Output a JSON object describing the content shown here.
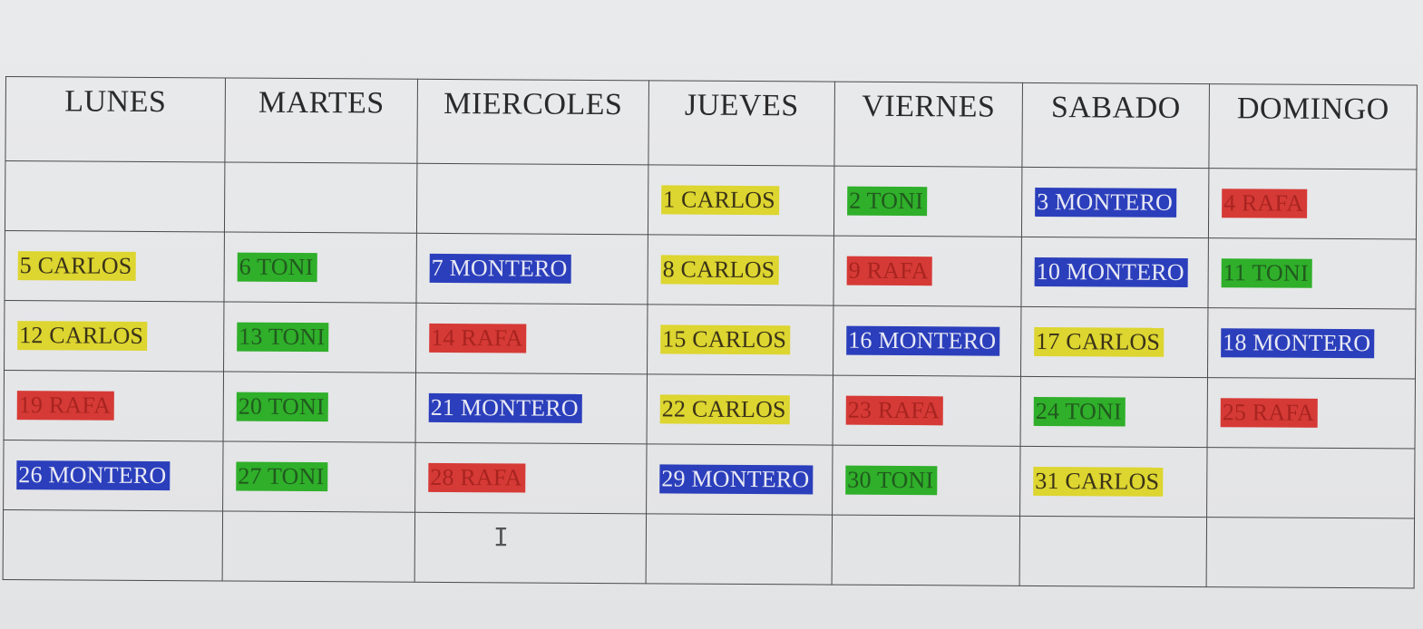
{
  "calendar": {
    "days": [
      "LUNES",
      "MARTES",
      "MIERCOLES",
      "JUEVES",
      "VIERNES",
      "SABADO",
      "DOMINGO"
    ],
    "colors": {
      "carlos": "#ddd530",
      "toni": "#2faf2a",
      "montero": "#2b3fbc",
      "rafa": "#d63a36"
    },
    "weeks": [
      [
        {
          "text": ""
        },
        {
          "text": ""
        },
        {
          "text": ""
        },
        {
          "text": "1 CARLOS",
          "person": "carlos"
        },
        {
          "text": "2 TONI",
          "person": "toni"
        },
        {
          "text": "3 MONTERO",
          "person": "montero"
        },
        {
          "text": "4 RAFA",
          "person": "rafa"
        }
      ],
      [
        {
          "text": "5 CARLOS",
          "person": "carlos"
        },
        {
          "text": "6 TONI",
          "person": "toni"
        },
        {
          "text": "7 MONTERO",
          "person": "montero"
        },
        {
          "text": "8 CARLOS",
          "person": "carlos"
        },
        {
          "text": "9 RAFA",
          "person": "rafa"
        },
        {
          "text": "10 MONTERO",
          "person": "montero"
        },
        {
          "text": "11 TONI",
          "person": "toni"
        }
      ],
      [
        {
          "text": "12 CARLOS",
          "person": "carlos"
        },
        {
          "text": "13 TONI",
          "person": "toni"
        },
        {
          "text": "14 RAFA",
          "person": "rafa"
        },
        {
          "text": "15 CARLOS",
          "person": "carlos"
        },
        {
          "text": "16 MONTERO",
          "person": "montero"
        },
        {
          "text": "17 CARLOS",
          "person": "carlos"
        },
        {
          "text": "18 MONTERO",
          "person": "montero"
        }
      ],
      [
        {
          "text": "19 RAFA",
          "person": "rafa"
        },
        {
          "text": "20 TONI",
          "person": "toni"
        },
        {
          "text": "21 MONTERO",
          "person": "montero"
        },
        {
          "text": "22 CARLOS",
          "person": "carlos"
        },
        {
          "text": "23 RAFA",
          "person": "rafa"
        },
        {
          "text": "24 TONI",
          "person": "toni"
        },
        {
          "text": "25 RAFA",
          "person": "rafa"
        }
      ],
      [
        {
          "text": "26 MONTERO",
          "person": "montero"
        },
        {
          "text": "27 TONI",
          "person": "toni"
        },
        {
          "text": "28 RAFA",
          "person": "rafa"
        },
        {
          "text": "29 MONTERO",
          "person": "montero"
        },
        {
          "text": "30 TONI",
          "person": "toni"
        },
        {
          "text": "31 CARLOS",
          "person": "carlos"
        },
        {
          "text": ""
        }
      ],
      [
        {
          "text": ""
        },
        {
          "text": ""
        },
        {
          "text": ""
        },
        {
          "text": ""
        },
        {
          "text": ""
        },
        {
          "text": ""
        },
        {
          "text": ""
        }
      ]
    ]
  },
  "cursor": {
    "icon": "text-cursor-icon",
    "glyph": "I"
  }
}
